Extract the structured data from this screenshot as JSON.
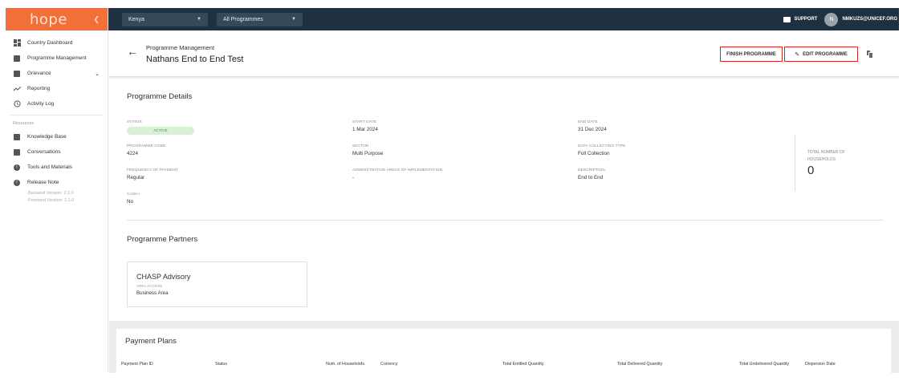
{
  "sidebar": {
    "logo": "hope",
    "collapse_icon": "chevron-left-icon",
    "items": [
      {
        "label": "Country Dashboard",
        "icon": "dashboard-icon"
      },
      {
        "label": "Programme Management",
        "icon": "document-icon"
      },
      {
        "label": "Grievance",
        "icon": "chat-icon"
      },
      {
        "label": "Reporting",
        "icon": "trend-icon"
      },
      {
        "label": "Activity Log",
        "icon": "history-icon"
      }
    ],
    "resources_label": "Resources",
    "resources": [
      {
        "label": "Knowledge Base",
        "icon": "book-icon"
      },
      {
        "label": "Conversations",
        "icon": "forum-icon"
      },
      {
        "label": "Tools and Materials",
        "icon": "info-icon"
      },
      {
        "label": "Release Note",
        "icon": "info-icon"
      }
    ],
    "backend_version": "Backend Version: 2.1.0",
    "frontend_version": "Frontend Version: 2.1.0"
  },
  "topbar": {
    "country": "Kenya",
    "programme": "All Programmes",
    "support": "SUPPORT",
    "avatar_letter": "N",
    "email": "NMKUZS@UNICEF.ORG"
  },
  "header": {
    "breadcrumb": "Programme Management",
    "title": "Nathans End to End Test",
    "finish_button": "FINISH PROGRAMME",
    "edit_button": "EDIT PROGRAMME"
  },
  "details": {
    "title": "Programme Details",
    "status_label": "STATUS",
    "status_value": "ACTIVE",
    "start_date_label": "START DATE",
    "start_date": "1 Mar 2024",
    "end_date_label": "END DATE",
    "end_date": "31 Dec 2024",
    "code_label": "PROGRAMME CODE",
    "code": "4224",
    "sector_label": "SECTOR",
    "sector": "Multi Purpose",
    "dct_label": "DATA COLLECTING TYPE",
    "dct": "Full Collection",
    "freq_label": "FREQUENCY OF PAYMENT",
    "freq": "Regular",
    "admin_label": "ADMINISTRATIVE AREAS OF IMPLEMENTATION",
    "admin": "-",
    "desc_label": "DESCRIPTION",
    "desc": "End to End",
    "cash_label": "CASH+",
    "cash": "No",
    "total_label": "TOTAL NUMBER OF HOUSEHOLDS",
    "total": "0"
  },
  "partners": {
    "title": "Programme Partners",
    "name": "CHASP Advisory",
    "area_label": "AREA ACCESS",
    "area": "Business Area"
  },
  "payment_plans": {
    "title": "Payment Plans",
    "columns": [
      "Payment Plan ID",
      "Status",
      "Num. of Households",
      "Currency",
      "Total Entitled Quantity",
      "Total Delivered Quantity",
      "Total Undelivered Quantity",
      "Dispersion Date"
    ]
  }
}
